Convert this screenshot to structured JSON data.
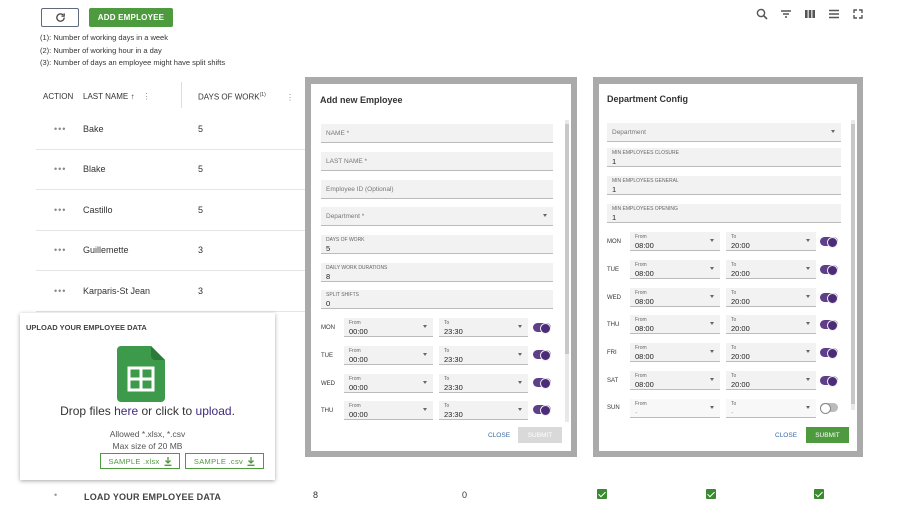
{
  "toolbar": {
    "add_label": "ADD EMPLOYEE"
  },
  "notes": [
    "(1): Number of working days in a week",
    "(2): Number of working hour in a day",
    "(3): Number of days an employee might have split shifts"
  ],
  "table": {
    "headers": {
      "action": "ACTION",
      "last_name": "LAST NAME",
      "days": "DAYS OF WORK",
      "days_sup": "(1)"
    },
    "rows": [
      {
        "dots": "•••",
        "name": "Bake",
        "days": "5"
      },
      {
        "dots": "•••",
        "name": "Blake",
        "days": "5"
      },
      {
        "dots": "•••",
        "name": "Castillo",
        "days": "5"
      },
      {
        "dots": "•••",
        "name": "Guillemette",
        "days": "3"
      },
      {
        "dots": "•••",
        "name": "Karparis-St Jean",
        "days": "3"
      }
    ],
    "footer": {
      "dot": "•",
      "label": "LOAD YOUR EMPLOYEE DATA",
      "v1": "8",
      "v2": "0"
    }
  },
  "upload": {
    "title": "UPLOAD YOUR EMPLOYEE DATA",
    "drop_prefix": "Drop files ",
    "drop_here": "here",
    "drop_mid": " or click to ",
    "drop_upload": "upload",
    "drop_suffix": ".",
    "allowed": "Allowed *.xlsx, *.csv",
    "max_size": "Max size of 20 MB",
    "sample_xlsx": "SAMPLE .xlsx",
    "sample_csv": "SAMPLE .csv"
  },
  "add_modal": {
    "title": "Add new Employee",
    "name_ph": "NAME *",
    "last_ph": "LAST NAME *",
    "id_ph": "Employee ID (Optional)",
    "dept_ph": "Department *",
    "days_label": "DAYS OF WORK",
    "days_value": "5",
    "daily_label": "DAILY WORK DURATIONS",
    "daily_value": "8",
    "split_label": "SPLIT SHIFTS",
    "split_value": "0",
    "from_label": "From",
    "to_label": "To",
    "days": [
      {
        "day": "MON",
        "from": "00:00",
        "to": "23:30"
      },
      {
        "day": "TUE",
        "from": "00:00",
        "to": "23:30"
      },
      {
        "day": "WED",
        "from": "00:00",
        "to": "23:30"
      },
      {
        "day": "THU",
        "from": "00:00",
        "to": "23:30"
      }
    ],
    "close": "CLOSE",
    "submit": "SUBMIT"
  },
  "dept_modal": {
    "title": "Department Config",
    "dept_ph": "Department",
    "closure_label": "MIN EMPLOYEES CLOSURE",
    "closure_value": "1",
    "general_label": "MIN EMPLOYEES GENERAL",
    "general_value": "1",
    "opening_label": "MIN EMPLOYEES OPENING",
    "opening_value": "1",
    "from_label": "From",
    "to_label": "To",
    "days": [
      {
        "day": "MON",
        "from": "08:00",
        "to": "20:00"
      },
      {
        "day": "TUE",
        "from": "08:00",
        "to": "20:00"
      },
      {
        "day": "WED",
        "from": "08:00",
        "to": "20:00"
      },
      {
        "day": "THU",
        "from": "08:00",
        "to": "20:00"
      },
      {
        "day": "FRI",
        "from": "08:00",
        "to": "20:00"
      },
      {
        "day": "SAT",
        "from": "08:00",
        "to": "20:00"
      },
      {
        "day": "SUN",
        "from": "-",
        "to": "-"
      }
    ],
    "close": "CLOSE",
    "submit": "SUBMIT"
  },
  "colors": {
    "primary_green": "#4e9a3e",
    "toggle_purple": "#5f3f8a",
    "sheet_green": "#3c9a4a"
  }
}
